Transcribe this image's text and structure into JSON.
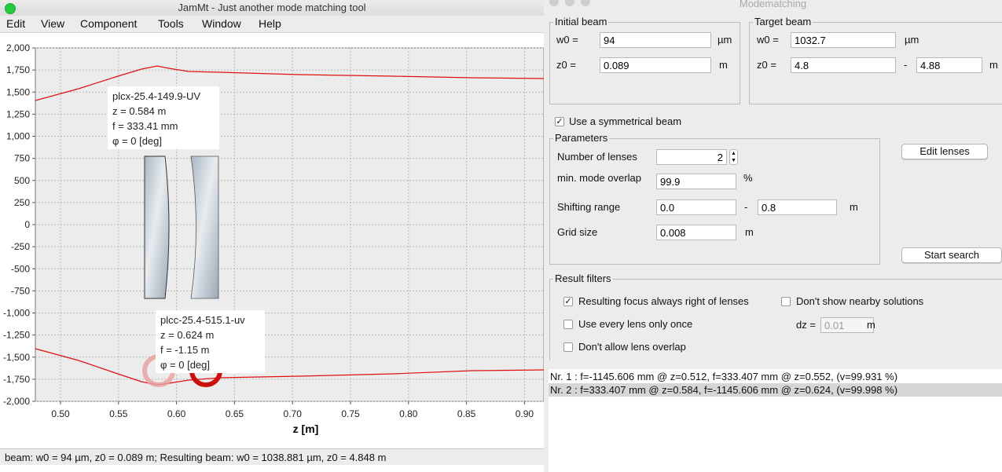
{
  "main_window": {
    "title": "JamMt - Just another mode matching tool",
    "menu": [
      "Edit",
      "View",
      "Component",
      "Tools",
      "Window",
      "Help"
    ]
  },
  "plot": {
    "xlabel": "z [m]",
    "x_ticks": [
      "0.50",
      "0.55",
      "0.60",
      "0.65",
      "0.70",
      "0.75",
      "0.80",
      "0.85",
      "0.90"
    ],
    "y_ticks": [
      "2,000",
      "1,750",
      "1,500",
      "1,250",
      "1,000",
      "750",
      "500",
      "250",
      "0",
      "-250",
      "-500",
      "-750",
      "-1,000",
      "-1,250",
      "-1,500",
      "-1,750",
      "-2,000"
    ],
    "colors": {
      "beam": "#e01010",
      "plot_bg": "#ececec",
      "grid": "#bfbfbf"
    },
    "lens1": {
      "name": "plcx-25.4-149.9-UV",
      "z": "z = 0.584 m",
      "f": "f = 333.41 mm",
      "phi": "φ = 0 [deg]"
    },
    "lens2": {
      "name": "plcc-25.4-515.1-uv",
      "z": "z = 0.624 m",
      "f": "f = -1.15 m",
      "phi": "φ = 0 [deg]"
    }
  },
  "status": "beam: w0 = 94 µm, z0 = 0.089 m; Resulting beam: w0 = 1038.881 µm, z0 = 4.848 m",
  "dialog": {
    "title": "Modematching",
    "initial_beam": {
      "title": "Initial beam",
      "w0_label": "w0 =",
      "w0_value": "94",
      "w0_unit": "µm",
      "z0_label": "z0 =",
      "z0_value": "0.089",
      "z0_unit": "m"
    },
    "target_beam": {
      "title": "Target beam",
      "w0_label": "w0 =",
      "w0_value": "1032.7",
      "w0_unit": "µm",
      "z0_label": "z0 =",
      "z0_from": "4.8",
      "dash": "-",
      "z0_to": "4.88",
      "z0_unit": "m"
    },
    "symmetrical": {
      "label": "Use a symmetrical beam",
      "checked": true
    },
    "parameters": {
      "title": "Parameters",
      "num_lenses_label": "Number of lenses",
      "num_lenses": "2",
      "overlap_label": "min. mode overlap",
      "overlap": "99.9",
      "overlap_unit": "%",
      "shift_label": "Shifting range",
      "shift_from": "0.0",
      "dash": "-",
      "shift_to": "0.8",
      "shift_unit": "m",
      "grid_label": "Grid size",
      "grid": "0.008",
      "grid_unit": "m"
    },
    "edit_lenses": "Edit lenses",
    "start_search": "Start search",
    "filters": {
      "title": "Result filters",
      "focus_right": {
        "label": "Resulting focus always right of lenses",
        "checked": true
      },
      "nearby": {
        "label": "Don't show nearby solutions",
        "checked": false
      },
      "once": {
        "label": "Use every lens only once",
        "checked": false
      },
      "overlap": {
        "label": "Don't allow lens overlap",
        "checked": false
      },
      "dz_label": "dz =",
      "dz_value": "0.01",
      "dz_unit": "m"
    },
    "results": [
      "Nr. 1 : f=-1145.606 mm @ z=0.512, f=333.407 mm @ z=0.552,  (v=99.931 %)",
      "Nr. 2 : f=333.407 mm @ z=0.584, f=-1145.606 mm @ z=0.624,  (v=99.998 %)"
    ]
  }
}
